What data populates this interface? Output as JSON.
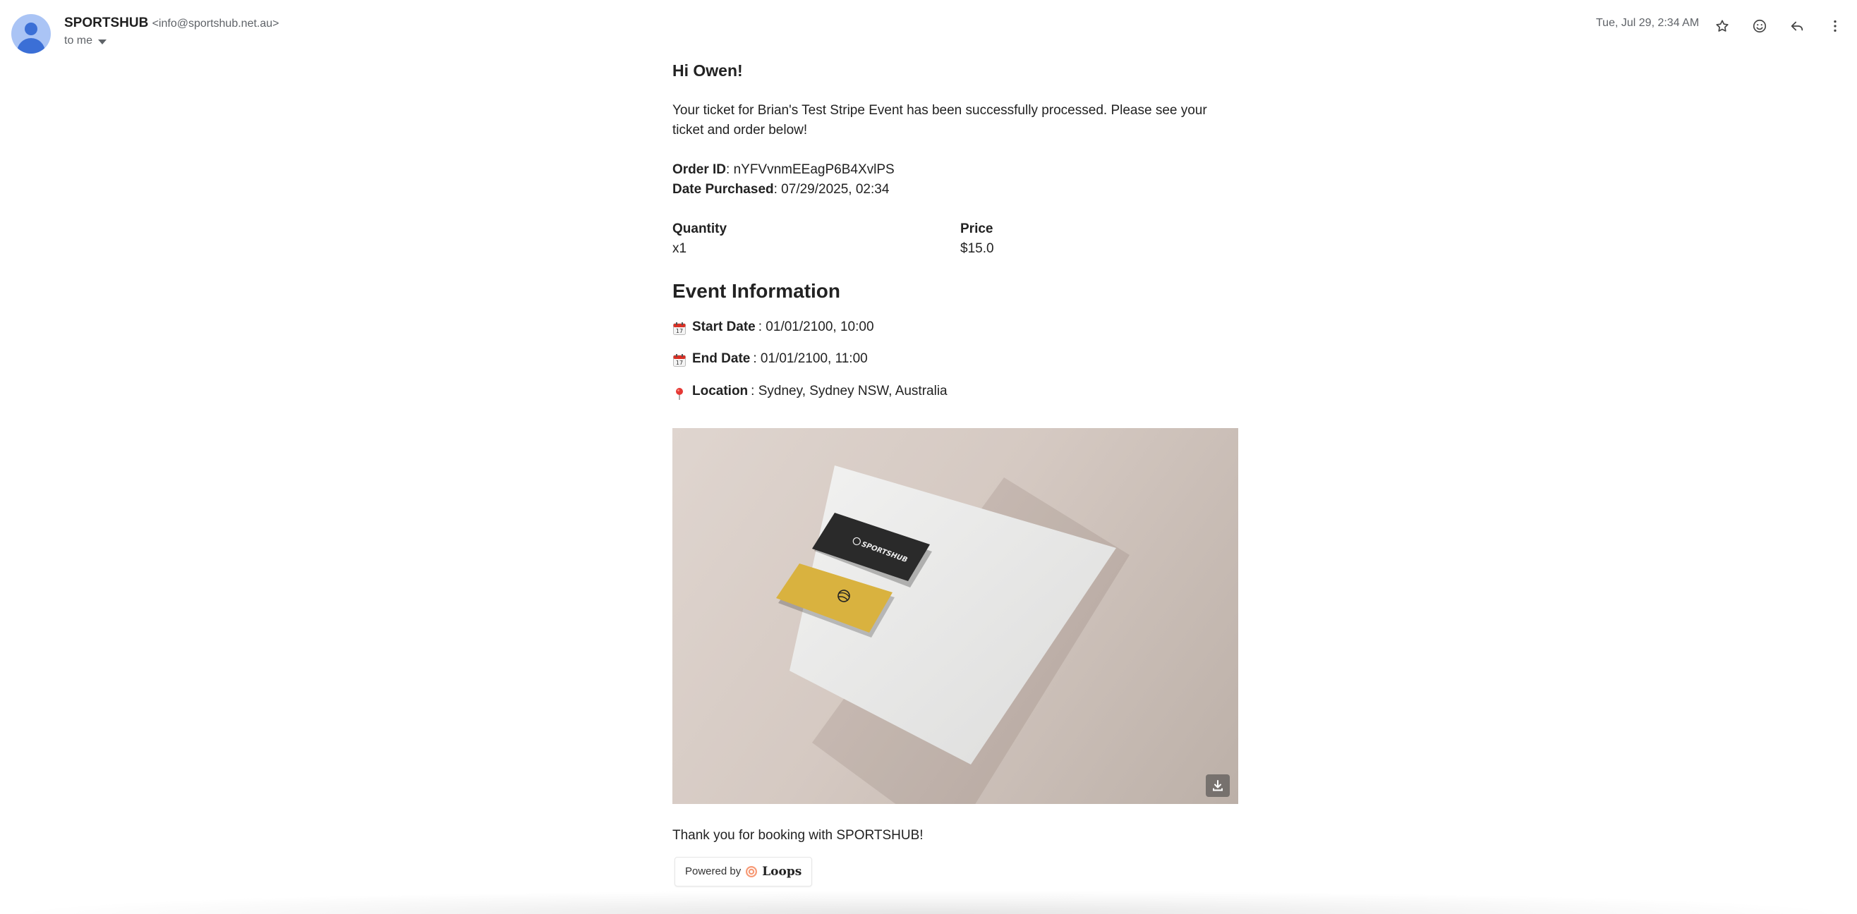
{
  "header": {
    "sender_name": "SPORTSHUB",
    "sender_email": "<info@sportshub.net.au>",
    "recipient": "to me",
    "date": "Tue, Jul 29, 2:34 AM",
    "icons": [
      "star-icon",
      "emoji-reaction-icon",
      "reply-icon",
      "more-options-icon"
    ]
  },
  "email": {
    "greeting": "Hi Owen!",
    "intro": "Your ticket for Brian's Test Stripe Event has been successfully processed. Please see your ticket and order below!",
    "order_id_label": "Order ID",
    "order_id": ": nYFVvnmEEagP6B4XvlPS",
    "date_purchased_label": "Date Purchased",
    "date_purchased": ": 07/29/2025, 02:34",
    "quantity_header": "Quantity",
    "quantity": "x1",
    "price_header": "Price",
    "price": "$15.0",
    "event_heading": "Event Information",
    "start_label": "Start Date",
    "start_value": ": 01/01/2100, 10:00",
    "end_label": "End Date",
    "end_value": ": 01/01/2100, 11:00",
    "location_label": "Location",
    "location_value": ": Sydney, Sydney NSW, Australia",
    "thanks": "Thank you for booking with SPORTSHUB!",
    "powered_by": "Powered by",
    "powered_brand": "Loops",
    "image_logo_text": "SPORTSHUB"
  },
  "colors": {
    "avatar_bg": "#aac4f5",
    "avatar_fg": "#3b6fd6",
    "card_yellow": "#d9b23f",
    "card_black": "#2a2a2a"
  }
}
